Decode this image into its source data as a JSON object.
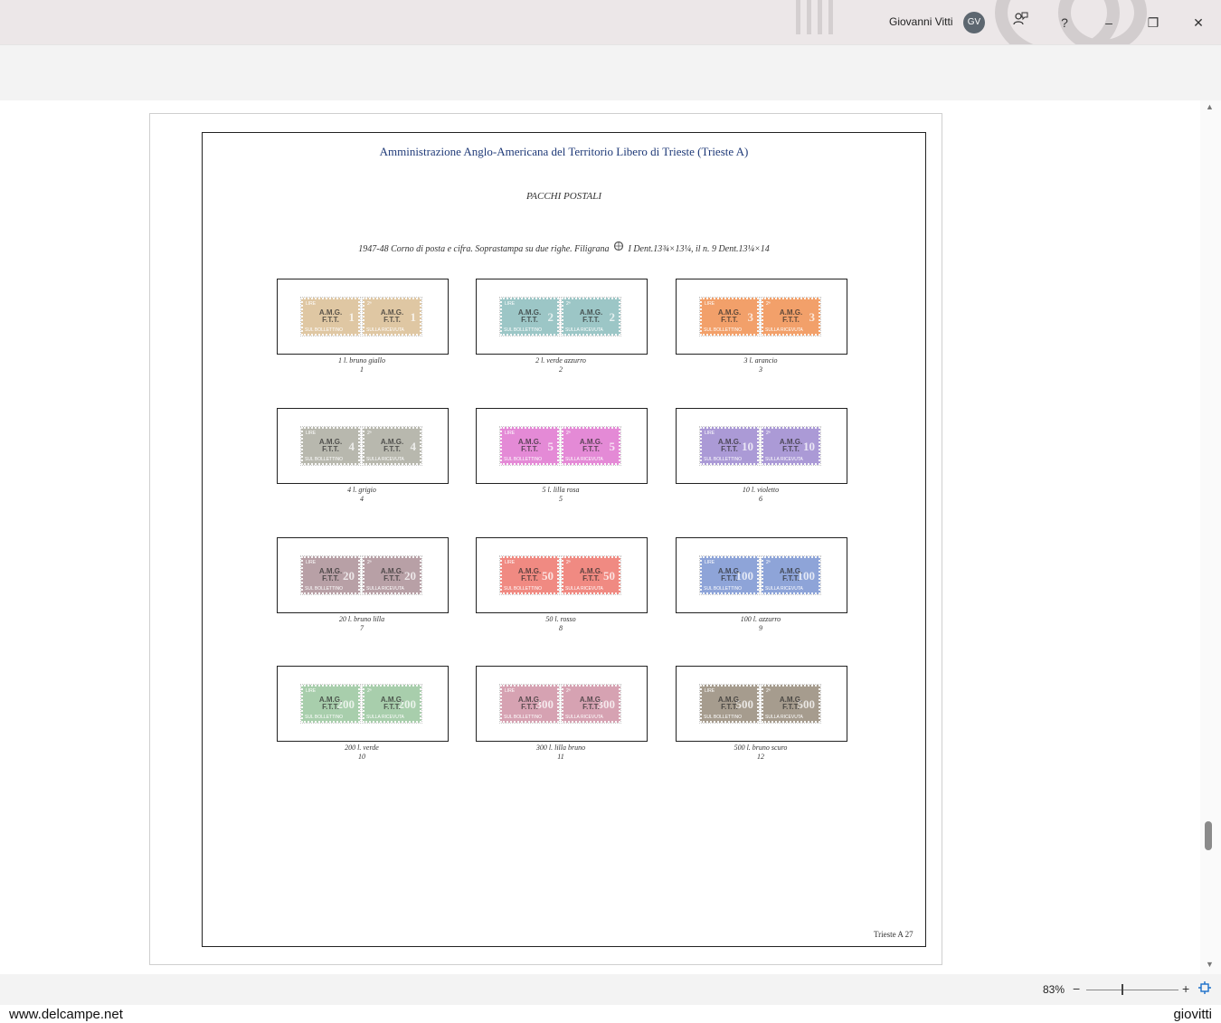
{
  "titlebar": {
    "user_name": "Giovanni Vitti",
    "avatar_initials": "GV",
    "help_label": "?",
    "minimize_label": "–",
    "restore_label": "❐",
    "close_label": "✕",
    "comment_icon": "comment-person-icon"
  },
  "document": {
    "title": "Amministrazione Anglo-Americana del Territorio Libero di Trieste  (Trieste A)",
    "subtitle": "PACCHI POSTALI",
    "description_part1": "1947-48 Corno di posta e cifra. Soprastampa su due righe. Filigrana",
    "watermark_icon": "watermark-wheel-icon",
    "description_part2": "I  Dent.13¾×13¼, il n. 9 Dent.13¼×14",
    "footer": "Trieste A   27",
    "stamp_left_header": "LIRE",
    "stamp_right_header": "2ª",
    "stamp_left_footer": "SUL BOLLETTINO",
    "stamp_right_footer": "SULLA RICEVUTA",
    "overprint_line1": "A.M.G.",
    "overprint_line2": "F.T.T.",
    "stamps": [
      {
        "caption": "1 l. bruno giallo",
        "number": "1",
        "color": "#dfc7a3",
        "value": "1"
      },
      {
        "caption": "2 l. verde azzurro",
        "number": "2",
        "color": "#9cc6c6",
        "value": "2"
      },
      {
        "caption": "3 l. arancio",
        "number": "3",
        "color": "#f2a06a",
        "value": "3"
      },
      {
        "caption": "4 l. grigio",
        "number": "4",
        "color": "#b8b8ae",
        "value": "4"
      },
      {
        "caption": "5 l. lilla rosa",
        "number": "5",
        "color": "#e48ad6",
        "value": "5"
      },
      {
        "caption": "10 l. violetto",
        "number": "6",
        "color": "#ab9ad6",
        "value": "10"
      },
      {
        "caption": "20 l. bruno lilla",
        "number": "7",
        "color": "#b8a0a6",
        "value": "20"
      },
      {
        "caption": "50 l. rosso",
        "number": "8",
        "color": "#f08a82",
        "value": "50"
      },
      {
        "caption": "100 l. azzurro",
        "number": "9",
        "color": "#8ea4d8",
        "value": "100"
      },
      {
        "caption": "200 l. verde",
        "number": "10",
        "color": "#a8ceac",
        "value": "200"
      },
      {
        "caption": "300 l. lilla bruno",
        "number": "11",
        "color": "#d6a2b2",
        "value": "300"
      },
      {
        "caption": "500 l. bruno scuro",
        "number": "12",
        "color": "#a69c8e",
        "value": "500"
      }
    ]
  },
  "status": {
    "zoom": "83%",
    "zoom_minus": "−",
    "zoom_plus": "+",
    "fit_icon": "fit-page-icon"
  },
  "scrollbar": {
    "up": "▲",
    "down": "▼"
  },
  "watermark": {
    "left": "www.delcampe.net",
    "right": "giovitti"
  }
}
